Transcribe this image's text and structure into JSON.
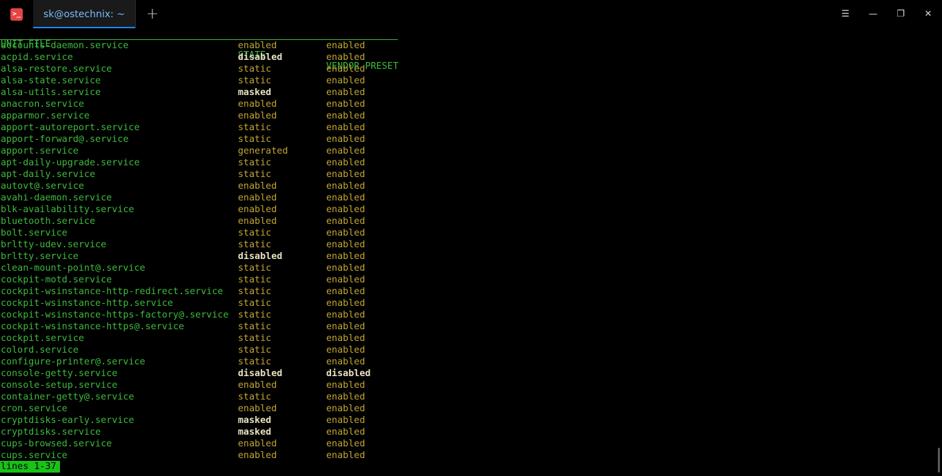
{
  "tab": {
    "title": "sk@ostechnix: ~"
  },
  "icons": {
    "app": "terminal-icon",
    "new_tab": "plus-icon",
    "menu": "hamburger-icon",
    "minimize": "minimize-icon",
    "maximize": "restore-icon",
    "close": "close-icon"
  },
  "glyphs": {
    "new_tab": "+",
    "menu": "☰",
    "minimize": "—",
    "maximize": "❐",
    "close": "✕"
  },
  "colors": {
    "terminal_bg": "#000000",
    "text_green": "#3dbb3d",
    "state_yellow": "#c2a633",
    "emphasis": "#e8e2c0",
    "status_bg": "#19c119",
    "tab_accent": "#1e88ff"
  },
  "table": {
    "headers": {
      "unit": "UNIT FILE",
      "state": "STATE",
      "vendor": "VENDOR PRESET"
    },
    "rows": [
      {
        "unit": "accounts-daemon.service",
        "state": "enabled",
        "vendor": "enabled"
      },
      {
        "unit": "acpid.service",
        "state": "disabled",
        "vendor": "enabled"
      },
      {
        "unit": "alsa-restore.service",
        "state": "static",
        "vendor": "enabled"
      },
      {
        "unit": "alsa-state.service",
        "state": "static",
        "vendor": "enabled"
      },
      {
        "unit": "alsa-utils.service",
        "state": "masked",
        "vendor": "enabled"
      },
      {
        "unit": "anacron.service",
        "state": "enabled",
        "vendor": "enabled"
      },
      {
        "unit": "apparmor.service",
        "state": "enabled",
        "vendor": "enabled"
      },
      {
        "unit": "apport-autoreport.service",
        "state": "static",
        "vendor": "enabled"
      },
      {
        "unit": "apport-forward@.service",
        "state": "static",
        "vendor": "enabled"
      },
      {
        "unit": "apport.service",
        "state": "generated",
        "vendor": "enabled"
      },
      {
        "unit": "apt-daily-upgrade.service",
        "state": "static",
        "vendor": "enabled"
      },
      {
        "unit": "apt-daily.service",
        "state": "static",
        "vendor": "enabled"
      },
      {
        "unit": "autovt@.service",
        "state": "enabled",
        "vendor": "enabled"
      },
      {
        "unit": "avahi-daemon.service",
        "state": "enabled",
        "vendor": "enabled"
      },
      {
        "unit": "blk-availability.service",
        "state": "enabled",
        "vendor": "enabled"
      },
      {
        "unit": "bluetooth.service",
        "state": "enabled",
        "vendor": "enabled"
      },
      {
        "unit": "bolt.service",
        "state": "static",
        "vendor": "enabled"
      },
      {
        "unit": "brltty-udev.service",
        "state": "static",
        "vendor": "enabled"
      },
      {
        "unit": "brltty.service",
        "state": "disabled",
        "vendor": "enabled"
      },
      {
        "unit": "clean-mount-point@.service",
        "state": "static",
        "vendor": "enabled"
      },
      {
        "unit": "cockpit-motd.service",
        "state": "static",
        "vendor": "enabled"
      },
      {
        "unit": "cockpit-wsinstance-http-redirect.service",
        "state": "static",
        "vendor": "enabled"
      },
      {
        "unit": "cockpit-wsinstance-http.service",
        "state": "static",
        "vendor": "enabled"
      },
      {
        "unit": "cockpit-wsinstance-https-factory@.service",
        "state": "static",
        "vendor": "enabled"
      },
      {
        "unit": "cockpit-wsinstance-https@.service",
        "state": "static",
        "vendor": "enabled"
      },
      {
        "unit": "cockpit.service",
        "state": "static",
        "vendor": "enabled"
      },
      {
        "unit": "colord.service",
        "state": "static",
        "vendor": "enabled"
      },
      {
        "unit": "configure-printer@.service",
        "state": "static",
        "vendor": "enabled"
      },
      {
        "unit": "console-getty.service",
        "state": "disabled",
        "vendor": "disabled"
      },
      {
        "unit": "console-setup.service",
        "state": "enabled",
        "vendor": "enabled"
      },
      {
        "unit": "container-getty@.service",
        "state": "static",
        "vendor": "enabled"
      },
      {
        "unit": "cron.service",
        "state": "enabled",
        "vendor": "enabled"
      },
      {
        "unit": "cryptdisks-early.service",
        "state": "masked",
        "vendor": "enabled"
      },
      {
        "unit": "cryptdisks.service",
        "state": "masked",
        "vendor": "enabled"
      },
      {
        "unit": "cups-browsed.service",
        "state": "enabled",
        "vendor": "enabled"
      },
      {
        "unit": "cups.service",
        "state": "enabled",
        "vendor": "enabled"
      }
    ]
  },
  "status_line": "lines 1-37"
}
